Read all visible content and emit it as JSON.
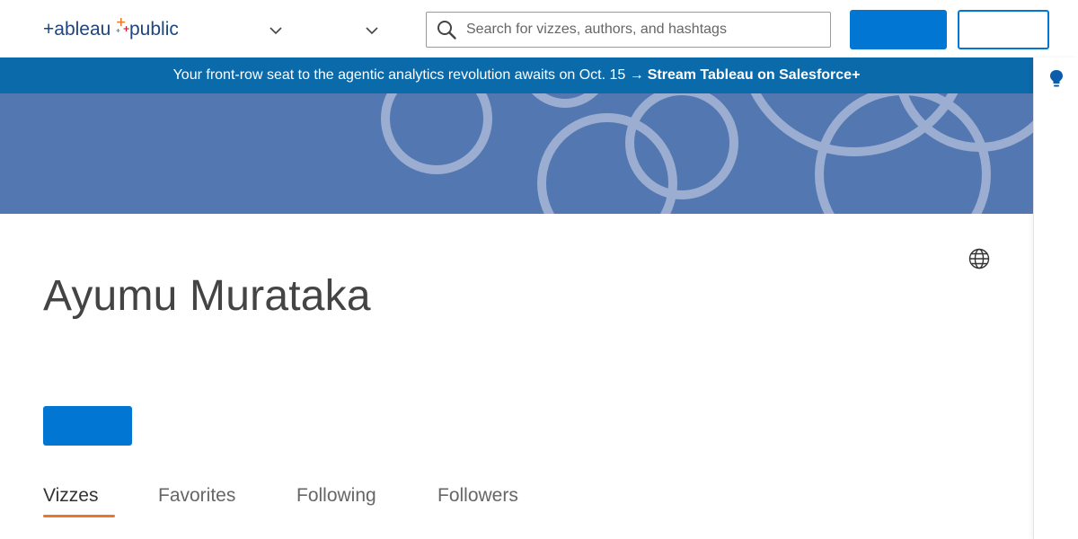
{
  "header": {
    "logo_text": "+ableau+public",
    "logo_left": "+ableau",
    "logo_right": "public",
    "nav": [
      {
        "label": "",
        "icon": "chevron-down-icon"
      },
      {
        "label": "",
        "icon": "chevron-down-icon"
      }
    ],
    "search": {
      "placeholder": "Search for vizzes, authors, and hashtags",
      "value": "",
      "icon": "search-icon"
    },
    "primary_button_label": "",
    "secondary_button_label": ""
  },
  "banner": {
    "text": "Your front-row seat to the agentic analytics revolution awaits on Oct. 15 →",
    "cta": "Stream Tableau on Salesforce+"
  },
  "rail": {
    "icon": "lightbulb-icon"
  },
  "profile": {
    "name": "Ayumu Murataka",
    "follow_label": "",
    "website_icon": "globe-icon"
  },
  "tabs": [
    {
      "label": "Vizzes",
      "active": true
    },
    {
      "label": "Favorites",
      "active": false
    },
    {
      "label": "Following",
      "active": false
    },
    {
      "label": "Followers",
      "active": false
    }
  ],
  "colors": {
    "accent": "#0176d3",
    "banner": "#0b6aa9",
    "cover": "#5277b1",
    "tab_underline": "#e8762c"
  }
}
